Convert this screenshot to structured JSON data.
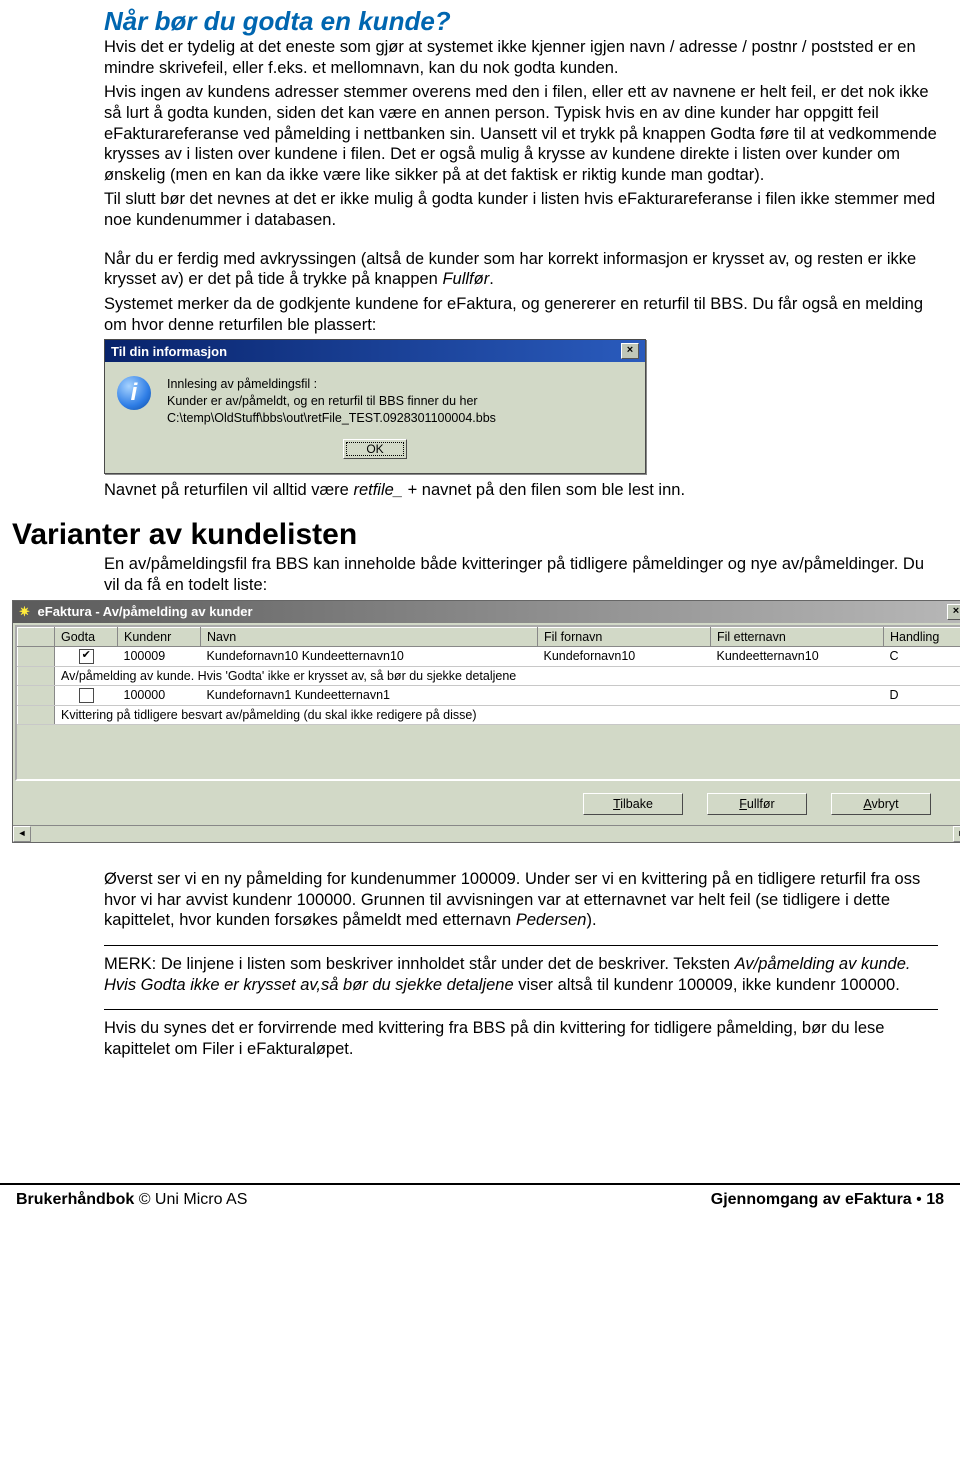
{
  "section1": {
    "title": "Når bør du godta en kunde?",
    "p1": "Hvis det er tydelig at det eneste som gjør at systemet ikke kjenner igjen navn / adresse / postnr / poststed er en mindre skrivefeil, eller f.eks. et mellomnavn, kan du nok godta kunden.",
    "p2": "Hvis ingen av kundens adresser stemmer overens med den i filen, eller ett av navnene er helt feil, er det nok ikke så lurt å godta kunden, siden det kan være en annen person. Typisk hvis en av dine kunder har oppgitt feil eFakturareferanse ved påmelding i nettbanken sin. Uansett vil et trykk på knappen Godta føre til at vedkommende krysses av i listen over kundene i filen. Det er også mulig å krysse av kundene direkte i listen over kunder om ønskelig (men en kan da ikke være like sikker på at det faktisk er riktig kunde man godtar).",
    "p3": "Til slutt bør det nevnes at det er ikke mulig å godta kunder i listen hvis eFakturareferanse i filen ikke stemmer med noe kundenummer i databasen.",
    "p4a": "Når du er ferdig med avkryssingen (altså de kunder som har korrekt informasjon er krysset av, og resten er ikke krysset av) er det på tide å trykke på knappen ",
    "p4b": "Fullfør",
    "p4c": ".",
    "p5": "Systemet merker da de godkjente kundene for eFaktura, og genererer en returfil til BBS. Du får også en melding om hvor denne returfilen ble plassert:"
  },
  "dialog1": {
    "title": "Til din informasjon",
    "text": "Innlesing av påmeldingsfil :\nKunder er av/påmeldt, og en returfil til BBS finner du her\nC:\\temp\\OldStuff\\bbs\\out\\retFile_TEST.0928301100004.bbs",
    "ok": "OK"
  },
  "afterdlg": {
    "a": "Navnet på returfilen vil alltid være ",
    "b": "retfile_",
    "c": " + navnet på den filen som ble lest inn."
  },
  "chapter": {
    "title": "Varianter av kundelisten",
    "intro": "En av/påmeldingsfil fra BBS kan inneholde både kvitteringer på tidligere påmeldinger og nye av/påmeldinger. Du vil da få en todelt liste:"
  },
  "listwin": {
    "title": "eFaktura - Av/påmelding av kunder",
    "headers": {
      "godta": "Godta",
      "kundenr": "Kundenr",
      "navn": "Navn",
      "filfornavn": "Fil fornavn",
      "filetternavn": "Fil etternavn",
      "handling": "Handling"
    },
    "row1": {
      "kundenr": "100009",
      "navn": "Kundefornavn10 Kundeetternavn10",
      "filfornavn": "Kundefornavn10",
      "filetternavn": "Kundeetternavn10",
      "handling": "C"
    },
    "group1": "Av/påmelding av kunde. Hvis 'Godta' ikke er krysset av, så bør du sjekke detaljene",
    "row2": {
      "kundenr": "100000",
      "navn": "Kundefornavn1 Kundeetternavn1",
      "filfornavn": "",
      "filetternavn": "",
      "handling": "D"
    },
    "group2": "Kvittering på tidligere besvart av/påmelding (du skal ikke redigere på disse)",
    "btn_tilbake": "Tilbake",
    "btn_fullfor": "Fullfør",
    "btn_avbryt": "Avbryt"
  },
  "after2": {
    "p1a": "Øverst ser vi en ny påmelding for kundenummer 100009. Under ser vi en kvittering på en tidligere returfil fra oss hvor vi har avvist kundenr 100000. Grunnen til avvisningen var at etternavnet var helt feil (se tidligere i dette kapittelet, hvor kunden forsøkes påmeldt med etternavn ",
    "p1b": "Pedersen",
    "p1c": ").",
    "p2a": "MERK: De linjene i listen som beskriver innholdet står under det de beskriver. Teksten ",
    "p2b": "Av/påmelding av kunde. Hvis Godta ikke er krysset av,så bør du sjekke detaljene",
    "p2c": " viser altså til kundenr 100009, ikke kundenr 100000.",
    "p3": "Hvis du synes det er forvirrende med kvittering fra BBS på din kvittering for tidligere påmelding, bør du lese kapittelet om Filer i eFakturaløpet."
  },
  "footer": {
    "left_a": "Brukerhåndbok",
    "left_b": " © Uni Micro AS",
    "right_a": "Gjennomgang av eFaktura ",
    "right_b": "•",
    "right_c": " 18"
  }
}
